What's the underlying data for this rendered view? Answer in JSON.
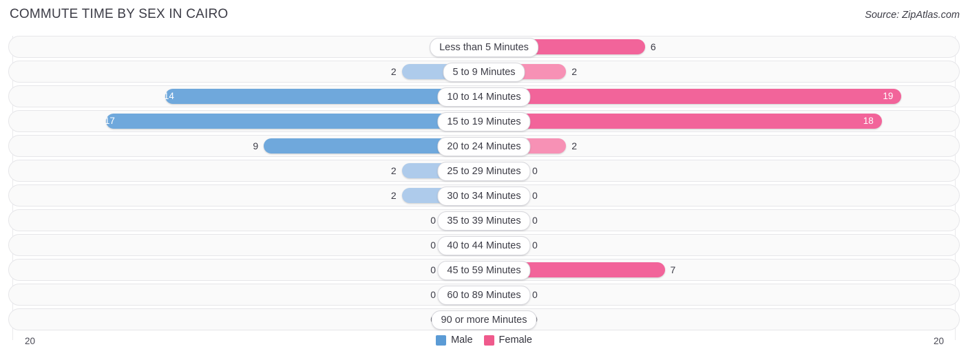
{
  "header": {
    "title": "COMMUTE TIME BY SEX IN CAIRO",
    "source": "Source: ZipAtlas.com"
  },
  "axis": {
    "left_label": "20",
    "right_label": "20"
  },
  "legend": {
    "items": [
      {
        "label": "Male",
        "color": "#5b9bd5"
      },
      {
        "label": "Female",
        "color": "#ef5a8c"
      }
    ]
  },
  "colors": {
    "male_strong": "#6fa8dc",
    "male_light": "#aecbeb",
    "female_strong": "#f2649a",
    "female_light": "#f791b5",
    "row_track": "#fafafa",
    "row_border": "#e6e6e9",
    "gridline": "#e9e9ec",
    "text": "#3c3c46"
  },
  "chart_data": {
    "type": "bar",
    "title": "COMMUTE TIME BY SEX IN CAIRO",
    "subtitle": "",
    "xlabel": "",
    "ylabel": "",
    "orientation": "horizontal-diverging",
    "axis_max": 20,
    "xlim": [
      20,
      20
    ],
    "grid": true,
    "legend_position": "bottom",
    "categories": [
      "Less than 5 Minutes",
      "5 to 9 Minutes",
      "10 to 14 Minutes",
      "15 to 19 Minutes",
      "20 to 24 Minutes",
      "25 to 29 Minutes",
      "30 to 34 Minutes",
      "35 to 39 Minutes",
      "40 to 44 Minutes",
      "45 to 59 Minutes",
      "60 to 89 Minutes",
      "90 or more Minutes"
    ],
    "series": [
      {
        "name": "Male",
        "values": [
          0,
          2,
          14,
          17,
          9,
          2,
          2,
          0,
          0,
          0,
          0,
          0
        ]
      },
      {
        "name": "Female",
        "values": [
          6,
          2,
          19,
          18,
          2,
          0,
          0,
          0,
          0,
          7,
          0,
          0
        ]
      }
    ]
  },
  "rows": [
    {
      "category": "Less than 5 Minutes",
      "male": "0",
      "female": "6"
    },
    {
      "category": "5 to 9 Minutes",
      "male": "2",
      "female": "2"
    },
    {
      "category": "10 to 14 Minutes",
      "male": "14",
      "female": "19"
    },
    {
      "category": "15 to 19 Minutes",
      "male": "17",
      "female": "18"
    },
    {
      "category": "20 to 24 Minutes",
      "male": "9",
      "female": "2"
    },
    {
      "category": "25 to 29 Minutes",
      "male": "2",
      "female": "0"
    },
    {
      "category": "30 to 34 Minutes",
      "male": "2",
      "female": "0"
    },
    {
      "category": "35 to 39 Minutes",
      "male": "0",
      "female": "0"
    },
    {
      "category": "40 to 44 Minutes",
      "male": "0",
      "female": "0"
    },
    {
      "category": "45 to 59 Minutes",
      "male": "0",
      "female": "7"
    },
    {
      "category": "60 to 89 Minutes",
      "male": "0",
      "female": "0"
    },
    {
      "category": "90 or more Minutes",
      "male": "0",
      "female": "0"
    }
  ]
}
